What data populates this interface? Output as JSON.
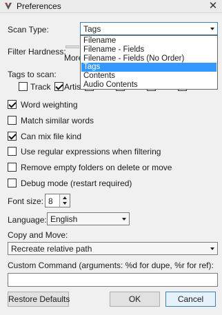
{
  "window": {
    "title": "Preferences",
    "close_glyph": "✕"
  },
  "scan_type": {
    "label": "Scan Type:",
    "value": "Tags",
    "options": [
      "Filename",
      "Filename - Fields",
      "Filename - Fields (No Order)",
      "Tags",
      "Contents",
      "Audio Contents"
    ],
    "selected_index": 3
  },
  "filter_hardness": {
    "label": "Filter Hardness:",
    "partial_label": "More"
  },
  "tags_to_scan": {
    "label": "Tags to scan:",
    "items": [
      {
        "label": "Track",
        "checked": false
      },
      {
        "label": "Artist",
        "checked": true
      }
    ]
  },
  "options": [
    {
      "label": "Word weighting",
      "checked": true
    },
    {
      "label": "Match similar words",
      "checked": false
    },
    {
      "label": "Can mix file kind",
      "checked": true
    },
    {
      "label": "Use regular expressions when filtering",
      "checked": false
    },
    {
      "label": "Remove empty folders on delete or move",
      "checked": false
    },
    {
      "label": "Debug mode (restart required)",
      "checked": false
    }
  ],
  "font_size": {
    "label": "Font size:",
    "value": "8"
  },
  "language": {
    "label": "Language:",
    "value": "English"
  },
  "copy_move": {
    "label": "Copy and Move:",
    "value": "Recreate relative path"
  },
  "custom_command": {
    "label": "Custom Command (arguments: %d for dupe, %r for ref):",
    "value": ""
  },
  "buttons": {
    "restore": "Restore Defaults",
    "ok": "OK",
    "cancel": "Cancel"
  },
  "colors": {
    "selection": "#3399ff",
    "focus_border": "#3c7fb1",
    "window_bg": "#f0f0f0"
  },
  "icons": {
    "app": "dupeguru-app-icon",
    "close": "close-icon",
    "combo_arrow": "chevron-down-icon"
  }
}
